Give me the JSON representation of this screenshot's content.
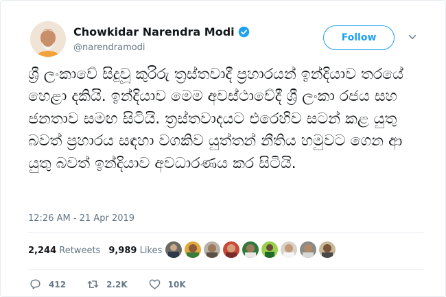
{
  "author": {
    "display_name": "Chowkidar Narendra Modi",
    "handle": "@narendramodi",
    "verified": true
  },
  "follow_label": "Follow",
  "tweet": {
    "text": "ශ්‍රී ලංකාවේ සිදුවූ කුරිරු ත්‍රස්තවාදී ප්‍රහාරයන් ඉන්දියාව තරයේ හෙළා දකියි. ඉන්දියාව මෙම අවස්ථාවේදී ශ්‍රී ලංකා රජය සහ ජනතාව සමඟ සිටියි. ත්‍රස්තවාදයට එරෙහිව සටන් කළ යුතු බවත් ප්‍රහාරය සඳහා වගකිව යුත්තන් නීතිය හමුවට ගෙන ආ යුතු බවත් ඉන්දියාව අවධාරණය කර සිටියි.",
    "timestamp": "12:26 AM - 21 Apr 2019"
  },
  "stats": {
    "retweets_count": "2,244",
    "retweets_label": "Retweets",
    "likes_count": "9,989",
    "likes_label": "Likes"
  },
  "actions": {
    "replies": "412",
    "retweets": "2.2K",
    "likes": "10K"
  },
  "colors": {
    "accent": "#1da1f2",
    "muted": "#657786",
    "text": "#14171a",
    "border": "#e6ecf0"
  },
  "liker_avatars": [
    "avatar-1",
    "avatar-2",
    "avatar-3",
    "avatar-4",
    "avatar-5",
    "avatar-6",
    "avatar-7",
    "avatar-8",
    "avatar-9"
  ]
}
